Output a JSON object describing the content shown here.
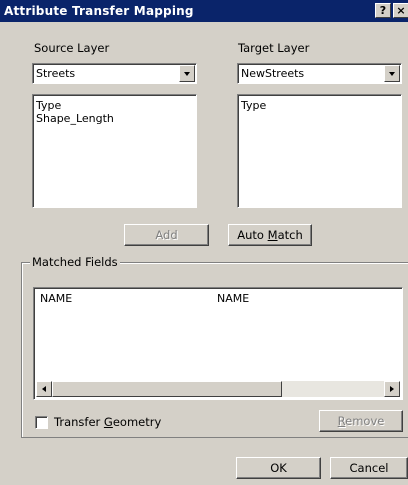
{
  "window": {
    "title": "Attribute Transfer Mapping",
    "help_glyph": "?",
    "close_glyph": "×"
  },
  "source": {
    "label": "Source Layer",
    "selected": "Streets",
    "fields": [
      "Type",
      "Shape_Length"
    ]
  },
  "target": {
    "label": "Target Layer",
    "selected": "NewStreets",
    "fields": [
      "Type"
    ]
  },
  "buttons": {
    "add": "Add",
    "auto_match_pre": "Auto ",
    "auto_match_key": "M",
    "auto_match_post": "atch",
    "remove_key": "R",
    "remove_post": "emove",
    "ok": "OK",
    "cancel": "Cancel"
  },
  "matched": {
    "legend": "Matched Fields",
    "rows": [
      {
        "source": "NAME",
        "target": "NAME"
      }
    ]
  },
  "transfer_geometry": {
    "label_pre": "Transfer ",
    "label_key": "G",
    "label_post": "eometry",
    "checked": false
  }
}
